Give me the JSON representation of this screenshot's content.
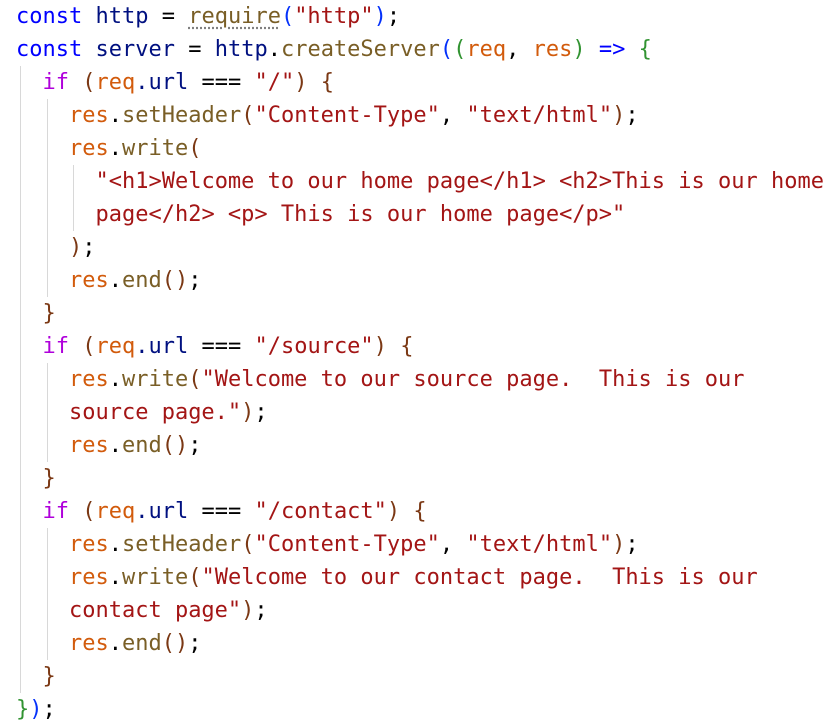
{
  "code_lines": [
    [
      {
        "t": "const ",
        "c": "storage"
      },
      {
        "t": "http",
        "c": "variable"
      },
      {
        "t": " = ",
        "c": "operator"
      },
      {
        "t": "require",
        "c": "function",
        "squiggle": true
      },
      {
        "t": "(",
        "c": "paren1"
      },
      {
        "t": "\"http\"",
        "c": "string"
      },
      {
        "t": ")",
        "c": "paren1"
      },
      {
        "t": ";",
        "c": "punct"
      }
    ],
    [
      {
        "t": "const ",
        "c": "storage"
      },
      {
        "t": "server",
        "c": "variable"
      },
      {
        "t": " = ",
        "c": "operator"
      },
      {
        "t": "http",
        "c": "variable"
      },
      {
        "t": ".",
        "c": "punct"
      },
      {
        "t": "createServer",
        "c": "function"
      },
      {
        "t": "(",
        "c": "paren1"
      },
      {
        "t": "(",
        "c": "paren2"
      },
      {
        "t": "req",
        "c": "resvar"
      },
      {
        "t": ", ",
        "c": "punct"
      },
      {
        "t": "res",
        "c": "resvar"
      },
      {
        "t": ") ",
        "c": "paren2"
      },
      {
        "t": "=> ",
        "c": "storage"
      },
      {
        "t": "{",
        "c": "paren2"
      }
    ],
    [
      {
        "t": "  ",
        "c": "plain"
      },
      {
        "t": "if ",
        "c": "keyword"
      },
      {
        "t": "(",
        "c": "paren3"
      },
      {
        "t": "req",
        "c": "resvar"
      },
      {
        "t": ".url ",
        "c": "variable"
      },
      {
        "t": "=== ",
        "c": "operator"
      },
      {
        "t": "\"/\"",
        "c": "string"
      },
      {
        "t": ") ",
        "c": "paren3"
      },
      {
        "t": "{",
        "c": "paren3"
      }
    ],
    [
      {
        "t": "    ",
        "c": "plain"
      },
      {
        "t": "res",
        "c": "resvar"
      },
      {
        "t": ".",
        "c": "punct"
      },
      {
        "t": "setHeader",
        "c": "function"
      },
      {
        "t": "(",
        "c": "paren3"
      },
      {
        "t": "\"Content-Type\"",
        "c": "string"
      },
      {
        "t": ", ",
        "c": "punct"
      },
      {
        "t": "\"text/html\"",
        "c": "string"
      },
      {
        "t": ")",
        "c": "paren3"
      },
      {
        "t": ";",
        "c": "punct"
      }
    ],
    [
      {
        "t": "    ",
        "c": "plain"
      },
      {
        "t": "res",
        "c": "resvar"
      },
      {
        "t": ".",
        "c": "punct"
      },
      {
        "t": "write",
        "c": "function"
      },
      {
        "t": "(",
        "c": "paren3"
      }
    ],
    [
      {
        "t": "      ",
        "c": "plain"
      },
      {
        "t": "\"<h1>Welcome to our home page</h1> <h2>This is our home",
        "c": "string"
      }
    ],
    [
      {
        "t": "      ",
        "c": "plain"
      },
      {
        "t": "page</h2> <p> This is our home page</p>\"",
        "c": "string"
      }
    ],
    [
      {
        "t": "    ",
        "c": "plain"
      },
      {
        "t": ")",
        "c": "paren3"
      },
      {
        "t": ";",
        "c": "punct"
      }
    ],
    [
      {
        "t": "    ",
        "c": "plain"
      },
      {
        "t": "res",
        "c": "resvar"
      },
      {
        "t": ".",
        "c": "punct"
      },
      {
        "t": "end",
        "c": "function"
      },
      {
        "t": "()",
        "c": "paren3"
      },
      {
        "t": ";",
        "c": "punct"
      }
    ],
    [
      {
        "t": "  ",
        "c": "plain"
      },
      {
        "t": "}",
        "c": "paren3"
      }
    ],
    [
      {
        "t": "  ",
        "c": "plain"
      },
      {
        "t": "if ",
        "c": "keyword"
      },
      {
        "t": "(",
        "c": "paren3"
      },
      {
        "t": "req",
        "c": "resvar"
      },
      {
        "t": ".url ",
        "c": "variable"
      },
      {
        "t": "=== ",
        "c": "operator"
      },
      {
        "t": "\"/source\"",
        "c": "string"
      },
      {
        "t": ") ",
        "c": "paren3"
      },
      {
        "t": "{",
        "c": "paren3"
      }
    ],
    [
      {
        "t": "    ",
        "c": "plain"
      },
      {
        "t": "res",
        "c": "resvar"
      },
      {
        "t": ".",
        "c": "punct"
      },
      {
        "t": "write",
        "c": "function"
      },
      {
        "t": "(",
        "c": "paren3"
      },
      {
        "t": "\"Welcome to our source page.  This is our",
        "c": "string"
      }
    ],
    [
      {
        "t": "    ",
        "c": "plain"
      },
      {
        "t": "source page.\"",
        "c": "string"
      },
      {
        "t": ")",
        "c": "paren3"
      },
      {
        "t": ";",
        "c": "punct"
      }
    ],
    [
      {
        "t": "    ",
        "c": "plain"
      },
      {
        "t": "res",
        "c": "resvar"
      },
      {
        "t": ".",
        "c": "punct"
      },
      {
        "t": "end",
        "c": "function"
      },
      {
        "t": "()",
        "c": "paren3"
      },
      {
        "t": ";",
        "c": "punct"
      }
    ],
    [
      {
        "t": "  ",
        "c": "plain"
      },
      {
        "t": "}",
        "c": "paren3"
      }
    ],
    [
      {
        "t": "  ",
        "c": "plain"
      },
      {
        "t": "if ",
        "c": "keyword"
      },
      {
        "t": "(",
        "c": "paren3"
      },
      {
        "t": "req",
        "c": "resvar"
      },
      {
        "t": ".url ",
        "c": "variable"
      },
      {
        "t": "=== ",
        "c": "operator"
      },
      {
        "t": "\"/contact\"",
        "c": "string"
      },
      {
        "t": ") ",
        "c": "paren3"
      },
      {
        "t": "{",
        "c": "paren3"
      }
    ],
    [
      {
        "t": "    ",
        "c": "plain"
      },
      {
        "t": "res",
        "c": "resvar"
      },
      {
        "t": ".",
        "c": "punct"
      },
      {
        "t": "setHeader",
        "c": "function"
      },
      {
        "t": "(",
        "c": "paren3"
      },
      {
        "t": "\"Content-Type\"",
        "c": "string"
      },
      {
        "t": ", ",
        "c": "punct"
      },
      {
        "t": "\"text/html\"",
        "c": "string"
      },
      {
        "t": ")",
        "c": "paren3"
      },
      {
        "t": ";",
        "c": "punct"
      }
    ],
    [
      {
        "t": "    ",
        "c": "plain"
      },
      {
        "t": "res",
        "c": "resvar"
      },
      {
        "t": ".",
        "c": "punct"
      },
      {
        "t": "write",
        "c": "function"
      },
      {
        "t": "(",
        "c": "paren3"
      },
      {
        "t": "\"Welcome to our contact page.  This is our",
        "c": "string"
      }
    ],
    [
      {
        "t": "    ",
        "c": "plain"
      },
      {
        "t": "contact page\"",
        "c": "string"
      },
      {
        "t": ")",
        "c": "paren3"
      },
      {
        "t": ";",
        "c": "punct"
      }
    ],
    [
      {
        "t": "    ",
        "c": "plain"
      },
      {
        "t": "res",
        "c": "resvar"
      },
      {
        "t": ".",
        "c": "punct"
      },
      {
        "t": "end",
        "c": "function"
      },
      {
        "t": "()",
        "c": "paren3"
      },
      {
        "t": ";",
        "c": "punct"
      }
    ],
    [
      {
        "t": "  ",
        "c": "plain"
      },
      {
        "t": "}",
        "c": "paren3"
      }
    ],
    [
      {
        "t": "}",
        "c": "paren2"
      },
      {
        "t": ")",
        "c": "paren1"
      },
      {
        "t": ";",
        "c": "punct"
      }
    ]
  ],
  "colors": {
    "storage": "#0000ff",
    "keyword": "#af00db",
    "variable": "#001080",
    "function": "#795e26",
    "string": "#a31515",
    "resvar": "#d25b0c",
    "paren1": "#0431fa",
    "paren2": "#319331",
    "paren3": "#7b3814",
    "indent_guide": "#d8d8d8"
  }
}
